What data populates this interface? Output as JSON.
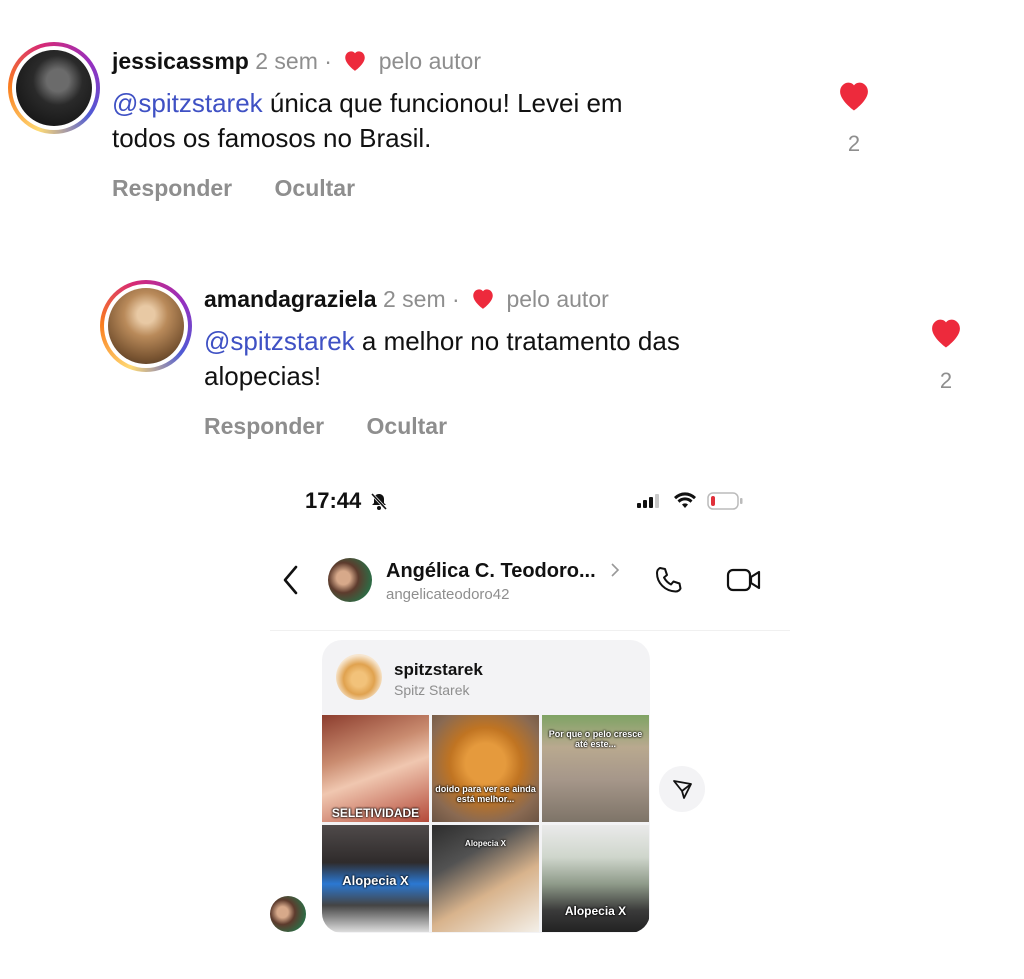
{
  "comments": [
    {
      "username": "jessicassmp",
      "time": "2 sem",
      "separator": "·",
      "liked_by": "pelo autor",
      "mention": "@spitzstarek",
      "text_line1": " única que funcionou! Levei em",
      "text_line2": "todos os famosos no Brasil.",
      "reply": "Responder",
      "hide": "Ocultar",
      "likes": "2"
    },
    {
      "username": "amandagraziela",
      "time": "2 sem",
      "separator": "·",
      "liked_by": "pelo autor",
      "mention": "@spitzstarek",
      "text_line1": " a melhor no tratamento das",
      "text_line2": "alopecias!",
      "reply": "Responder",
      "hide": "Ocultar",
      "likes": "2"
    }
  ],
  "phone": {
    "status_time": "17:44",
    "chat_name": "Angélica C. Teodoro...",
    "chat_handle": "angelicateodoro42",
    "shared_profile": {
      "username": "spitzstarek",
      "name": "Spitz Starek",
      "tiles": [
        {
          "caption": "SELETIVIDADE"
        },
        {
          "caption": "doido para ver se ainda está melhor..."
        },
        {
          "caption": "Por que o pelo cresce até este..."
        },
        {
          "caption": "Alopecia X"
        },
        {
          "caption": "Alopecia X"
        },
        {
          "caption": "Alopecia X"
        }
      ]
    }
  },
  "colors": {
    "heart": "#ed2a3c",
    "mention": "#3f51c4",
    "meta": "#8e8e8e"
  },
  "icons": [
    "heart-icon",
    "bell-slash-icon",
    "signal-icon",
    "wifi-icon",
    "battery-icon",
    "back-chevron-icon",
    "phone-icon",
    "video-icon",
    "send-icon"
  ]
}
